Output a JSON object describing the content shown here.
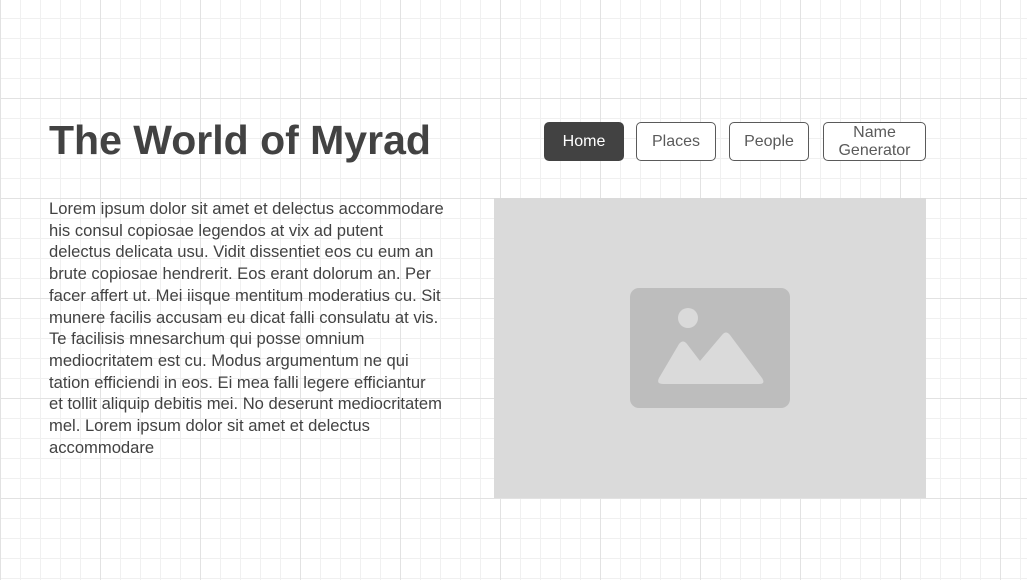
{
  "header": {
    "title": "The World of Myrad"
  },
  "nav": {
    "items": [
      {
        "label": "Home",
        "active": true
      },
      {
        "label": "Places",
        "active": false
      },
      {
        "label": "People",
        "active": false
      },
      {
        "label": "Name Generator",
        "active": false
      }
    ]
  },
  "main": {
    "body_text": "Lorem ipsum dolor sit amet et delectus accommodare his consul copiosae legendos at vix ad putent delectus delicata usu. Vidit dissentiet eos cu eum an brute copiosae hendrerit. Eos erant dolorum an. Per facer affert ut. Mei iisque mentitum moderatius cu. Sit munere facilis accusam eu dicat falli consulatu at vis. Te facilisis mnesarchum qui posse omnium mediocritatem est cu. Modus argumentum ne qui tation efficiendi in eos. Ei mea falli legere efficiantur et tollit aliquip debitis mei. No deserunt mediocritatem mel. Lorem ipsum dolor sit amet et delectus accommodare",
    "image": {
      "icon": "image-placeholder-icon"
    }
  },
  "colors": {
    "text": "#424242",
    "active_button": "#424242",
    "button_border": "#5a5a5a",
    "placeholder_bg": "#dadada",
    "placeholder_icon": "#bdbdbd"
  }
}
